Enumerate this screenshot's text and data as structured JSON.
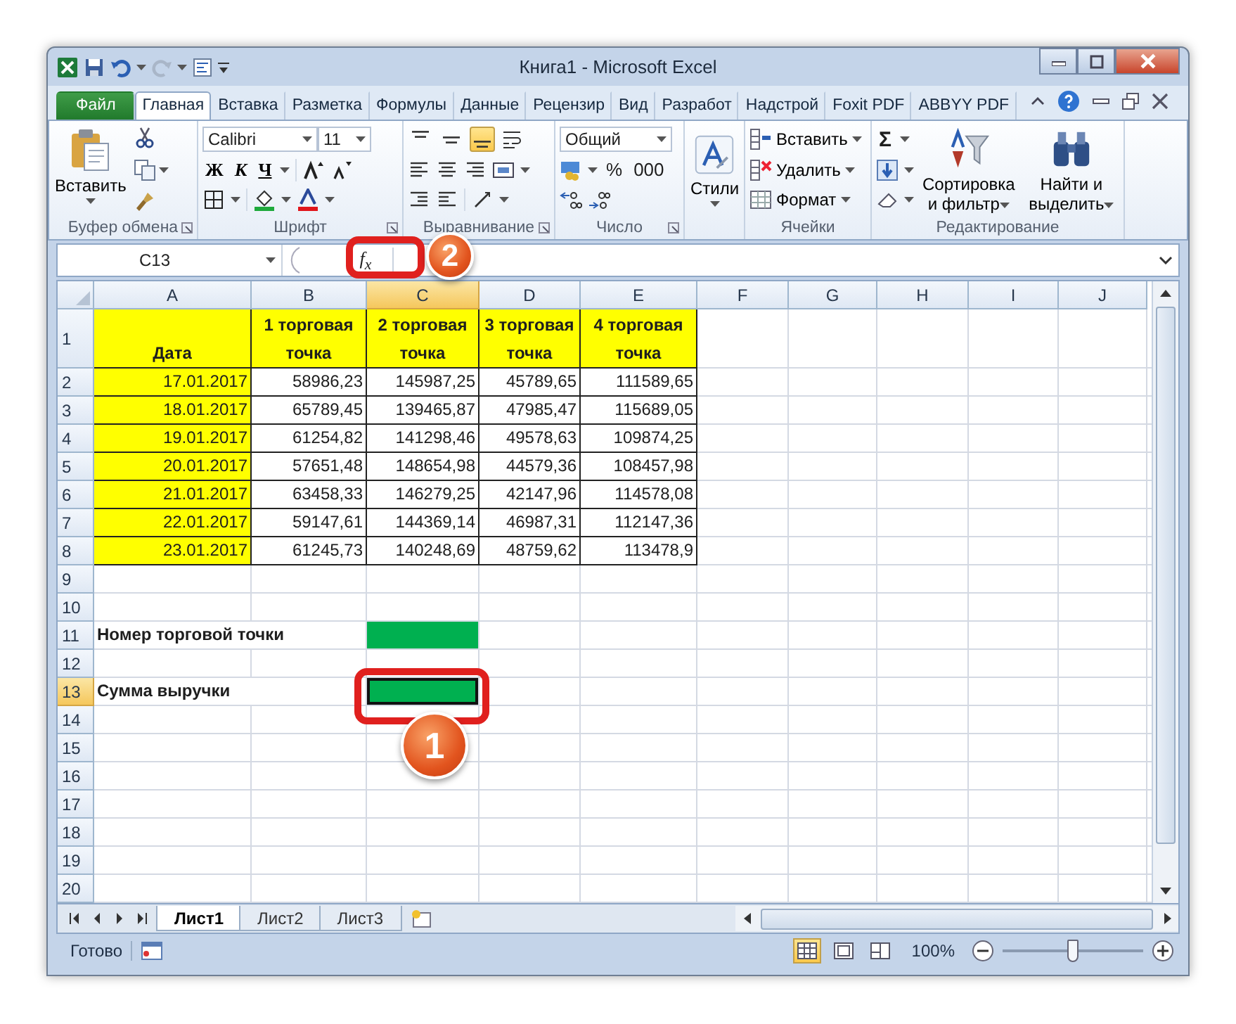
{
  "window": {
    "title": "Книга1 - Microsoft Excel"
  },
  "ribbon_tabs": [
    {
      "label": "Файл",
      "kind": "file",
      "selected": false
    },
    {
      "label": "Главная",
      "kind": "tab",
      "selected": true
    },
    {
      "label": "Вставка",
      "kind": "tab",
      "selected": false
    },
    {
      "label": "Разметка",
      "kind": "tab",
      "selected": false
    },
    {
      "label": "Формулы",
      "kind": "tab",
      "selected": false
    },
    {
      "label": "Данные",
      "kind": "tab",
      "selected": false
    },
    {
      "label": "Рецензир",
      "kind": "tab",
      "selected": false
    },
    {
      "label": "Вид",
      "kind": "tab",
      "selected": false
    },
    {
      "label": "Разработ",
      "kind": "tab",
      "selected": false
    },
    {
      "label": "Надстрой",
      "kind": "tab",
      "selected": false
    },
    {
      "label": "Foxit PDF",
      "kind": "tab",
      "selected": false
    },
    {
      "label": "ABBYY PDF",
      "kind": "tab",
      "selected": false
    }
  ],
  "ribbon_groups": [
    {
      "kind": "clipboard",
      "label": "Буфер обмена",
      "paste": "Вставить"
    },
    {
      "kind": "font",
      "label": "Шрифт",
      "font": "Calibri",
      "size": "11",
      "bold": "Ж",
      "italic": "К",
      "underline": "Ч"
    },
    {
      "kind": "alignment",
      "label": "Выравнивание",
      "vertical_alignment": [
        {
          "selected": false
        },
        {
          "selected": false
        },
        {
          "selected": true
        }
      ]
    },
    {
      "kind": "number",
      "label": "Число",
      "format": "Общий",
      "percent": "%",
      "thousands": "000"
    },
    {
      "kind": "styles",
      "button": "Стили"
    },
    {
      "kind": "cells",
      "label": "Ячейки",
      "commands": [
        "Вставить",
        "Удалить",
        "Формат"
      ]
    },
    {
      "kind": "editing",
      "label": "Редактирование",
      "sum": "Σ",
      "sort": "Сортировка и фильтр",
      "find": "Найти и выделить"
    }
  ],
  "formula_bar": {
    "name_box": "C13",
    "function_button": "f$_{x}$"
  },
  "columns": [
    {
      "label": "A",
      "selected": false
    },
    {
      "label": "B",
      "selected": false
    },
    {
      "label": "C",
      "selected": true
    },
    {
      "label": "D",
      "selected": false
    },
    {
      "label": "E",
      "selected": false
    },
    {
      "label": "F",
      "selected": false
    },
    {
      "label": "G",
      "selected": false
    },
    {
      "label": "H",
      "selected": false
    },
    {
      "label": "I",
      "selected": false
    },
    {
      "label": "J",
      "selected": false
    }
  ],
  "rows": [
    {
      "number": "1",
      "selected": false,
      "cells": [
        {
          "kind": "heading",
          "text": "Дата",
          "color": "#ffff00"
        },
        {
          "kind": "heading",
          "text": "1 торговая точка",
          "color": "#ffff00"
        },
        {
          "kind": "heading",
          "text": "2 торговая точка",
          "color": "#ffff00"
        },
        {
          "kind": "heading",
          "text": "3 торговая точка",
          "color": "#ffff00"
        },
        {
          "kind": "heading",
          "text": "4 торговая точка",
          "color": "#ffff00"
        }
      ]
    },
    {
      "number": "2",
      "selected": false,
      "cells": [
        {
          "kind": "value",
          "text": "17.01.2017",
          "color": "#ffff00"
        },
        {
          "kind": "value",
          "text": "58986,23"
        },
        {
          "kind": "value",
          "text": "145987,25"
        },
        {
          "kind": "value",
          "text": "45789,65"
        },
        {
          "kind": "value",
          "text": "111589,65"
        }
      ]
    },
    {
      "number": "3",
      "selected": false,
      "cells": [
        {
          "kind": "value",
          "text": "18.01.2017",
          "color": "#ffff00"
        },
        {
          "kind": "value",
          "text": "65789,45"
        },
        {
          "kind": "value",
          "text": "139465,87"
        },
        {
          "kind": "value",
          "text": "47985,47"
        },
        {
          "kind": "value",
          "text": "115689,05"
        }
      ]
    },
    {
      "number": "4",
      "selected": false,
      "cells": [
        {
          "kind": "value",
          "text": "19.01.2017",
          "color": "#ffff00"
        },
        {
          "kind": "value",
          "text": "61254,82"
        },
        {
          "kind": "value",
          "text": "141298,46"
        },
        {
          "kind": "value",
          "text": "49578,63"
        },
        {
          "kind": "value",
          "text": "109874,25"
        }
      ]
    },
    {
      "number": "5",
      "selected": false,
      "cells": [
        {
          "kind": "value",
          "text": "20.01.2017",
          "color": "#ffff00"
        },
        {
          "kind": "value",
          "text": "57651,48"
        },
        {
          "kind": "value",
          "text": "148654,98"
        },
        {
          "kind": "value",
          "text": "44579,36"
        },
        {
          "kind": "value",
          "text": "108457,98"
        }
      ]
    },
    {
      "number": "6",
      "selected": false,
      "cells": [
        {
          "kind": "value",
          "text": "21.01.2017",
          "color": "#ffff00"
        },
        {
          "kind": "value",
          "text": "63458,33"
        },
        {
          "kind": "value",
          "text": "146279,25"
        },
        {
          "kind": "value",
          "text": "42147,96"
        },
        {
          "kind": "value",
          "text": "114578,08"
        }
      ]
    },
    {
      "number": "7",
      "selected": false,
      "cells": [
        {
          "kind": "value",
          "text": "22.01.2017",
          "color": "#ffff00"
        },
        {
          "kind": "value",
          "text": "59147,61"
        },
        {
          "kind": "value",
          "text": "144369,14"
        },
        {
          "kind": "value",
          "text": "46987,31"
        },
        {
          "kind": "value",
          "text": "112147,36"
        }
      ]
    },
    {
      "number": "8",
      "selected": false,
      "cells": [
        {
          "kind": "value",
          "text": "23.01.2017",
          "color": "#ffff00"
        },
        {
          "kind": "value",
          "text": "61245,73"
        },
        {
          "kind": "value",
          "text": "140248,69"
        },
        {
          "kind": "value",
          "text": "48759,62"
        },
        {
          "kind": "value",
          "text": "113478,9"
        }
      ]
    },
    {
      "number": "9",
      "selected": false,
      "cells": []
    },
    {
      "number": "10",
      "selected": false,
      "cells": []
    },
    {
      "number": "11",
      "selected": false,
      "cells": [
        {
          "kind": "label",
          "text": "Номер торговой точки"
        },
        {
          "kind": "fill",
          "color": "#00b050"
        }
      ]
    },
    {
      "number": "12",
      "selected": false,
      "cells": []
    },
    {
      "number": "13",
      "selected": true,
      "cells": [
        {
          "kind": "label",
          "text": "Сумма выручки"
        },
        {
          "kind": "fill",
          "color": "#00b050"
        }
      ]
    },
    {
      "number": "14",
      "selected": false,
      "cells": []
    },
    {
      "number": "15",
      "selected": false,
      "cells": []
    },
    {
      "number": "16",
      "selected": false,
      "cells": []
    },
    {
      "number": "17",
      "selected": false,
      "cells": []
    },
    {
      "number": "18",
      "selected": false,
      "cells": []
    },
    {
      "number": "19",
      "selected": false,
      "cells": []
    },
    {
      "number": "20",
      "selected": false,
      "cells": []
    }
  ],
  "callouts": [
    {
      "number": "1",
      "kind": "cell"
    },
    {
      "number": "2",
      "kind": "function"
    }
  ],
  "sheet_tabs": [
    {
      "label": "Лист1",
      "selected": true
    },
    {
      "label": "Лист2",
      "selected": false
    },
    {
      "label": "Лист3",
      "selected": false
    }
  ],
  "status_bar": {
    "text": "Готово",
    "views": [
      {
        "selected": true
      },
      {
        "selected": false
      },
      {
        "selected": false
      }
    ],
    "zoom": "100%",
    "zoom_slider": {
      "level": 0.5
    }
  }
}
